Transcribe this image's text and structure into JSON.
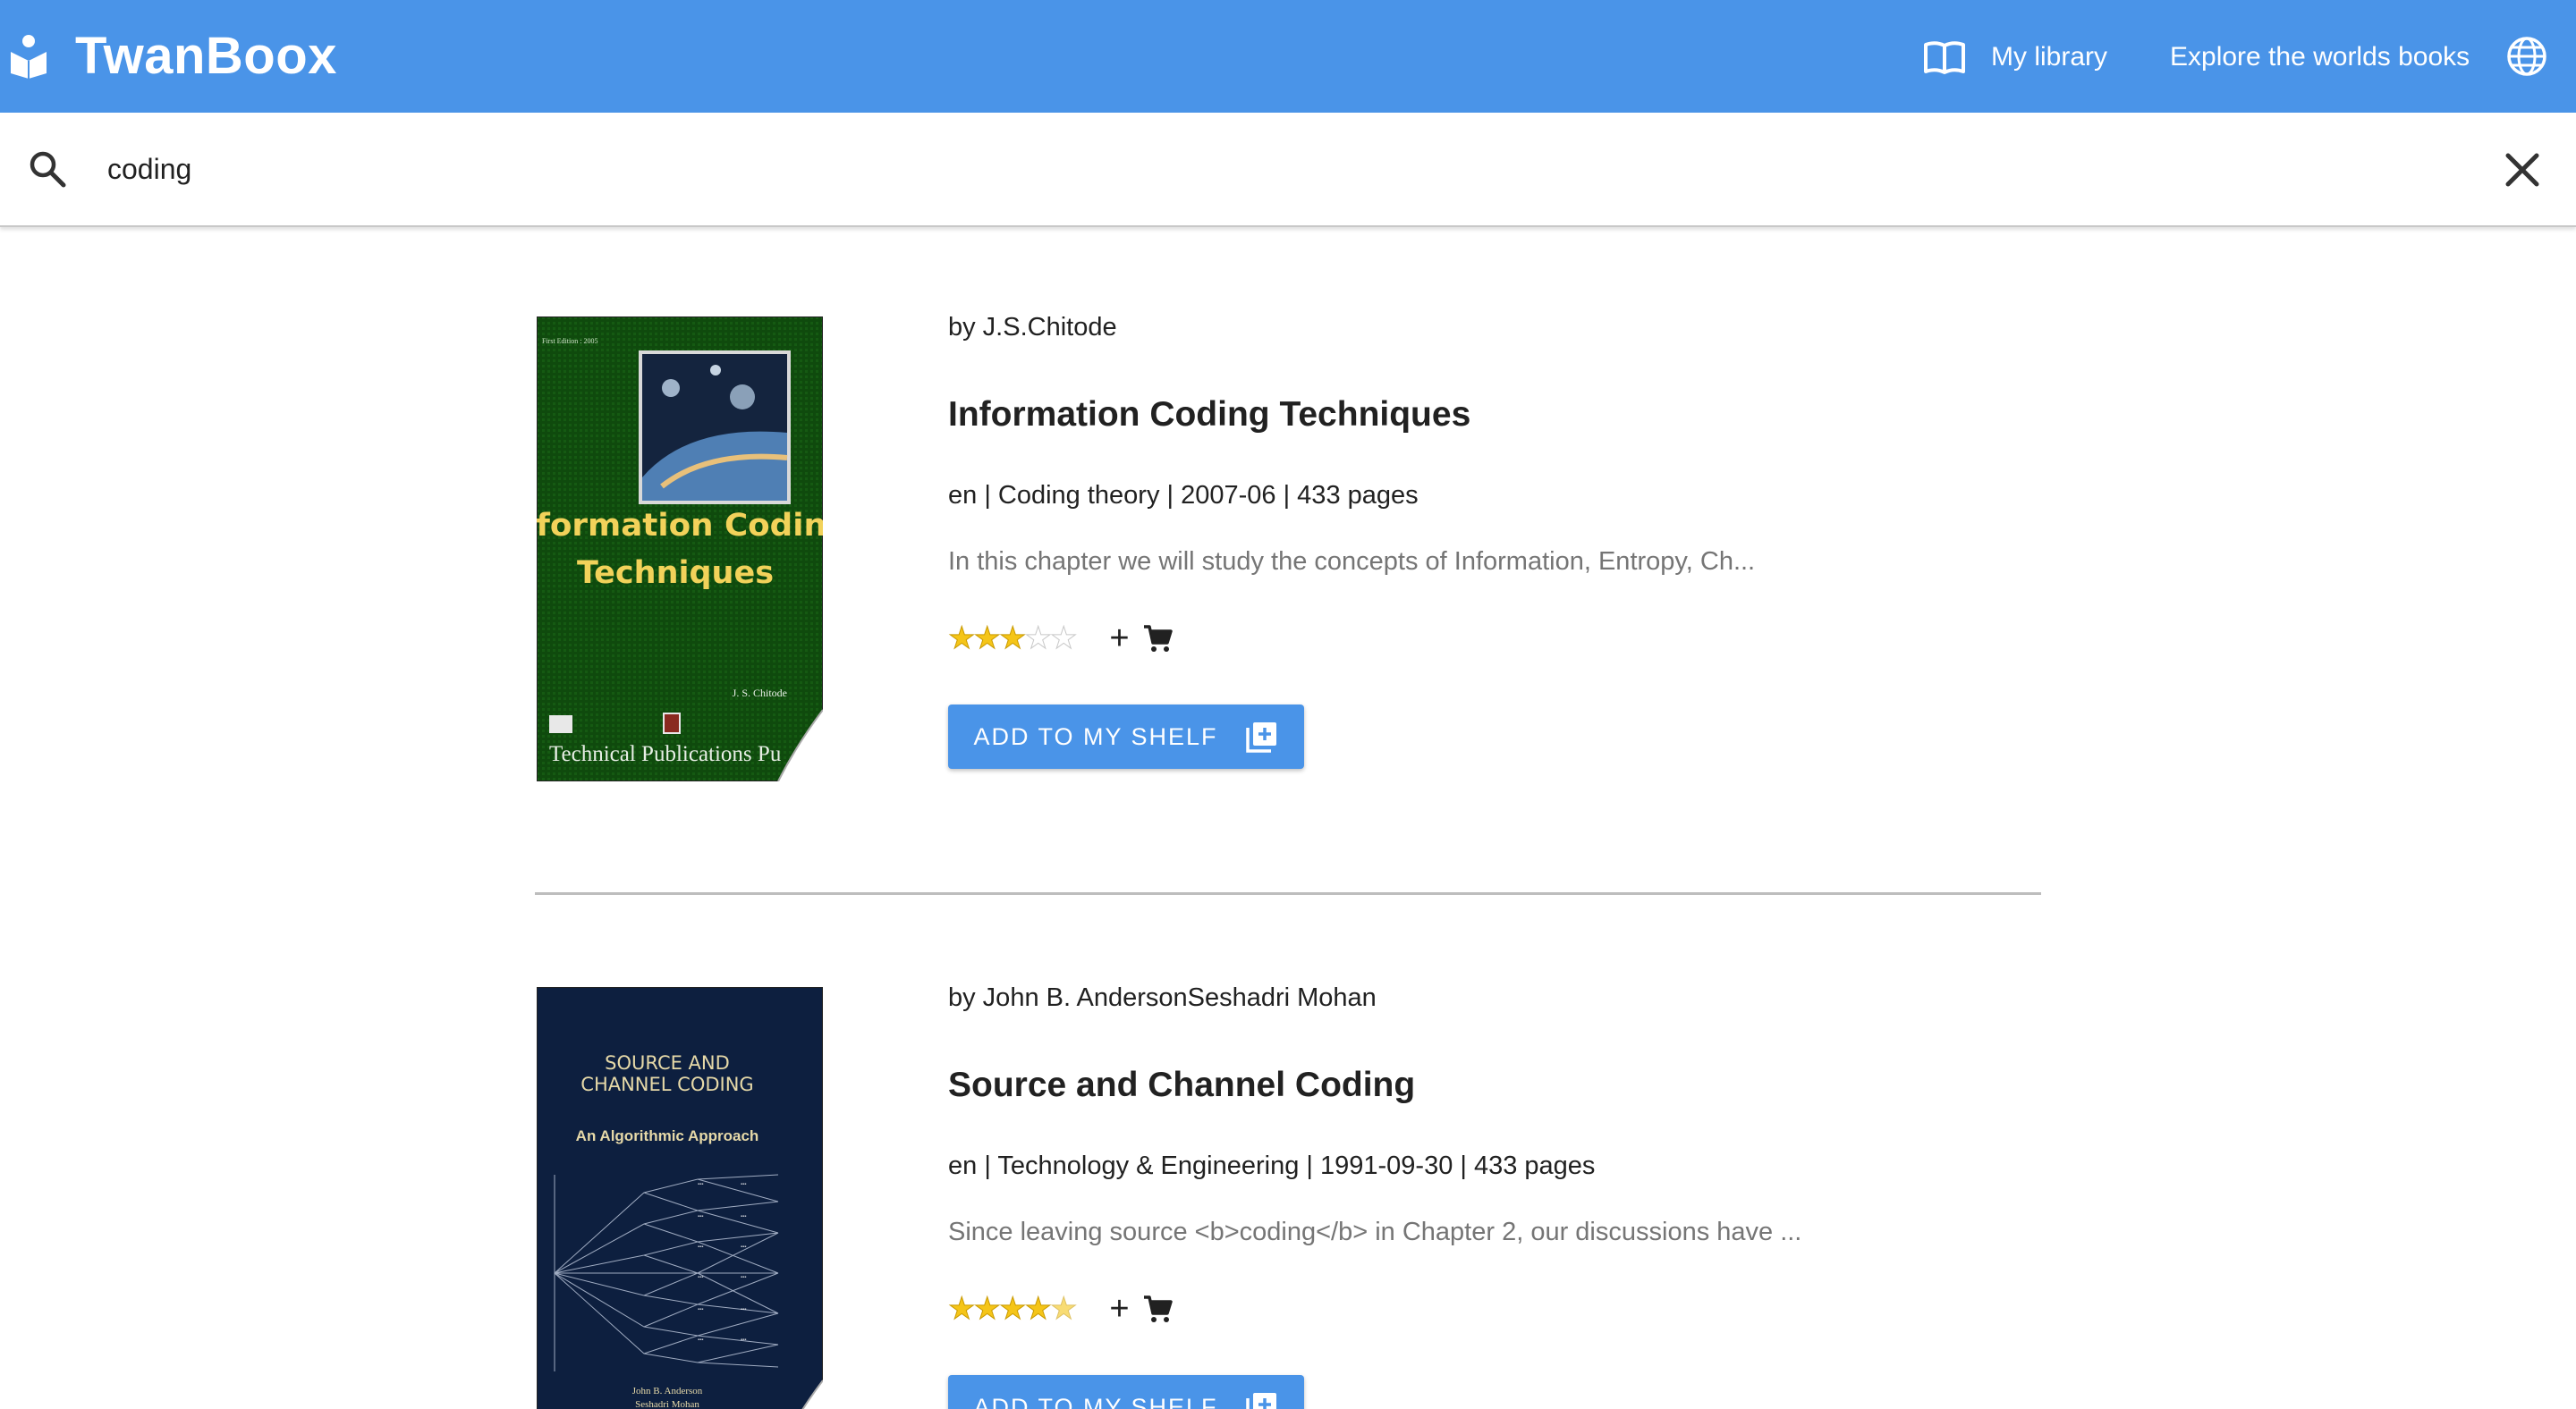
{
  "app": {
    "brand": "TwanBoox",
    "nav_library": "My library",
    "nav_explore": "Explore the worlds books",
    "accent_color": "#4a94e8"
  },
  "search": {
    "value": "coding",
    "placeholder": ""
  },
  "results": [
    {
      "author": "by J.S.Chitode",
      "title": "Information Coding Techniques",
      "meta": "en | Coding theory | 2007-06 | 433 pages",
      "snippet": "In this chapter we will study the concepts of Information, Entropy, Ch...",
      "rating": 3,
      "rating_max": 5,
      "plus_label": "+",
      "shelf_button": "ADD TO MY SHELF",
      "cover": {
        "edition": "First Edition : 2005",
        "title_line1": "Information Coding",
        "title_line2": "Techniques",
        "author": "J. S. Chitode",
        "publisher": "Technical Publications Pu"
      }
    },
    {
      "author": "by John B. AndersonSeshadri Mohan",
      "title": "Source and Channel Coding",
      "meta": "en | Technology & Engineering | 1991-09-30 | 433 pages",
      "snippet": "Since leaving source <b>coding</b> in Chapter 2, our discussions have ...",
      "rating": 4.5,
      "rating_max": 5,
      "plus_label": "+",
      "shelf_button": "ADD TO MY SHELF",
      "cover": {
        "title_line1": "SOURCE AND",
        "title_line2": "CHANNEL CODING",
        "subtitle": "An Algorithmic Approach",
        "author1": "John B. Anderson",
        "author2": "Seshadri Mohan"
      }
    }
  ]
}
